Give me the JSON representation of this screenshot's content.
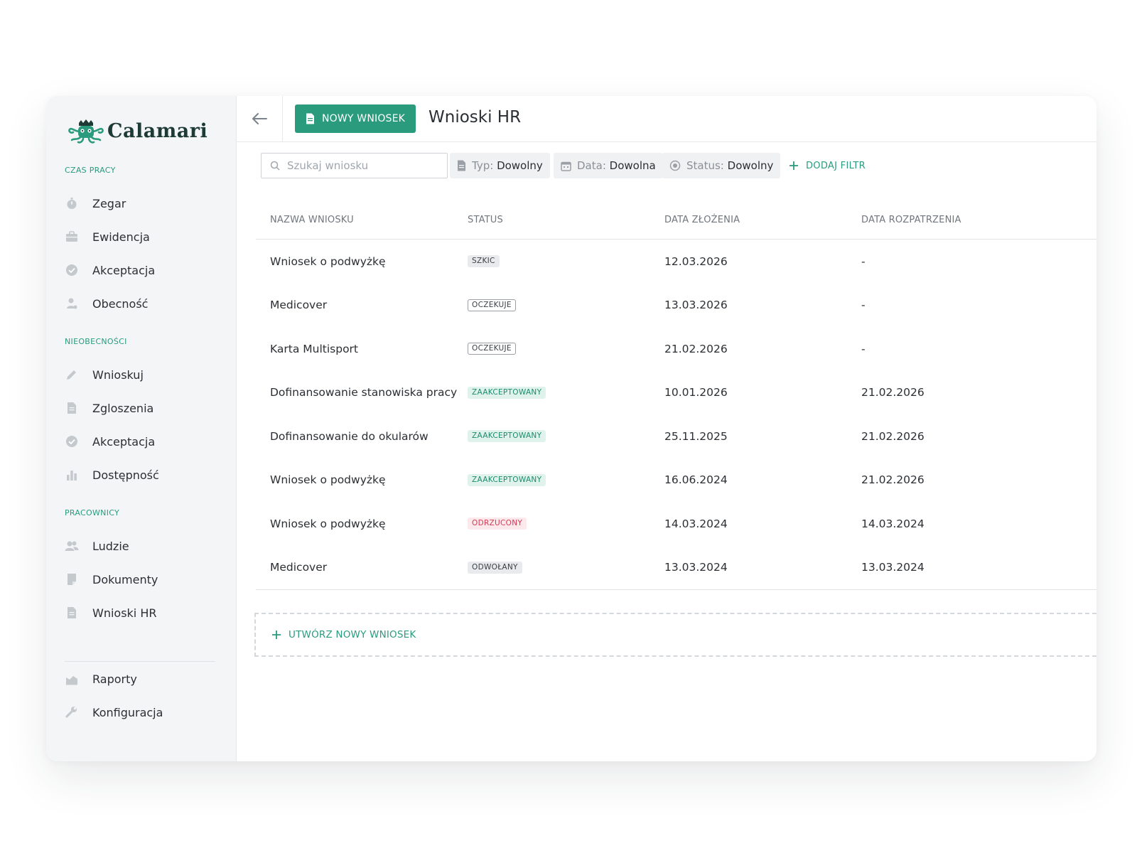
{
  "app": {
    "brand": "Calamari",
    "accent_color": "#2a9b7d"
  },
  "sidebar": {
    "sections": [
      {
        "title": "CZAS PRACY"
      },
      {
        "title": "NIEOBECNOŚCI"
      },
      {
        "title": "PRACOWNICY"
      }
    ],
    "items": [
      {
        "label": "Zegar",
        "icon": "stopwatch-icon"
      },
      {
        "label": "Ewidencja",
        "icon": "briefcase-icon"
      },
      {
        "label": "Akceptacja",
        "icon": "check-circle-icon"
      },
      {
        "label": "Obecność",
        "icon": "person-pin-icon"
      },
      {
        "label": "Wnioskuj",
        "icon": "pencil-icon"
      },
      {
        "label": "Zgloszenia",
        "icon": "document-icon"
      },
      {
        "label": "Akceptacja",
        "icon": "check-circle-icon"
      },
      {
        "label": "Dostępność",
        "icon": "bar-chart-icon"
      },
      {
        "label": "Ludzie",
        "icon": "people-icon"
      },
      {
        "label": "Dokumenty",
        "icon": "file-icon"
      },
      {
        "label": "Wnioski HR",
        "icon": "document-icon"
      },
      {
        "label": "Raporty",
        "icon": "area-chart-icon"
      },
      {
        "label": "Konfiguracja",
        "icon": "wrench-icon"
      }
    ]
  },
  "header": {
    "new_button_label": "NOWY WNIOSEK",
    "title": "Wnioski HR"
  },
  "filters": {
    "search_placeholder": "Szukaj wniosku",
    "search_value": "",
    "type_key": "Typ:",
    "type_value": "Dowolny",
    "date_key": "Data:",
    "date_value": "Dowolna",
    "status_key": "Status:",
    "status_value": "Dowolny",
    "add_filter_label": "DODAJ FILTR"
  },
  "table": {
    "columns": [
      "NAZWA WNIOSKU",
      "STATUS",
      "DATA ZŁOŻENIA",
      "DATA ROZPATRZENIA"
    ],
    "rows": [
      {
        "name": "Wniosek o podwyżkę",
        "status": "SZKIC",
        "status_kind": "szkic",
        "submitted": "12.03.2026",
        "reviewed": "-"
      },
      {
        "name": "Medicover",
        "status": "OCZEKUJE",
        "status_kind": "oczekuje",
        "submitted": "13.03.2026",
        "reviewed": "-"
      },
      {
        "name": "Karta Multisport",
        "status": "OCZEKUJE",
        "status_kind": "oczekuje",
        "submitted": "21.02.2026",
        "reviewed": "-"
      },
      {
        "name": "Dofinansowanie stanowiska pracy",
        "status": "ZAAKCEPTOWANY",
        "status_kind": "zaakceptowany",
        "submitted": "10.01.2026",
        "reviewed": "21.02.2026"
      },
      {
        "name": "Dofinansowanie do okularów",
        "status": "ZAAKCEPTOWANY",
        "status_kind": "zaakceptowany",
        "submitted": "25.11.2025",
        "reviewed": "21.02.2026"
      },
      {
        "name": "Wniosek o podwyżkę",
        "status": "ZAAKCEPTOWANY",
        "status_kind": "zaakceptowany",
        "submitted": "16.06.2024",
        "reviewed": "21.02.2026"
      },
      {
        "name": "Wniosek o podwyżkę",
        "status": "ODRZUCONY",
        "status_kind": "odrzucony",
        "submitted": "14.03.2024",
        "reviewed": "14.03.2024"
      },
      {
        "name": "Medicover",
        "status": "ODWOŁANY",
        "status_kind": "odwolany",
        "submitted": "13.03.2024",
        "reviewed": "13.03.2024"
      }
    ]
  },
  "create_new_label": "UTWÓRZ NOWY WNIOSEK"
}
